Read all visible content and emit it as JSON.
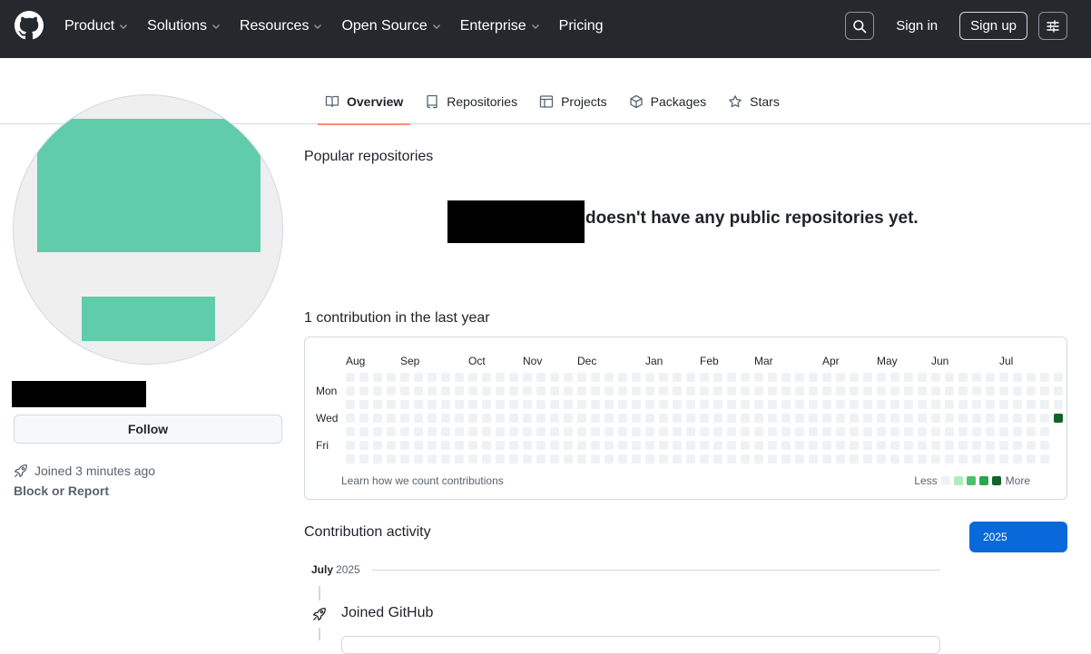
{
  "header": {
    "nav": [
      {
        "label": "Product",
        "dropdown": true
      },
      {
        "label": "Solutions",
        "dropdown": true
      },
      {
        "label": "Resources",
        "dropdown": true
      },
      {
        "label": "Open Source",
        "dropdown": true
      },
      {
        "label": "Enterprise",
        "dropdown": true
      },
      {
        "label": "Pricing",
        "dropdown": false
      }
    ],
    "sign_in": "Sign in",
    "sign_up": "Sign up"
  },
  "tabs": [
    {
      "label": "Overview",
      "icon": "book-icon",
      "active": true
    },
    {
      "label": "Repositories",
      "icon": "repo-icon",
      "active": false
    },
    {
      "label": "Projects",
      "icon": "table-icon",
      "active": false
    },
    {
      "label": "Packages",
      "icon": "package-icon",
      "active": false
    },
    {
      "label": "Stars",
      "icon": "star-icon",
      "active": false
    }
  ],
  "sidebar": {
    "follow_label": "Follow",
    "joined": "Joined 3 minutes ago",
    "block_report": "Block or Report"
  },
  "popular": {
    "title": "Popular repositories",
    "empty_message": "doesn't have any public repositories yet."
  },
  "contributions": {
    "title": "1 contribution in the last year",
    "months": [
      "Aug",
      "Sep",
      "Oct",
      "Nov",
      "Dec",
      "Jan",
      "Feb",
      "Mar",
      "Apr",
      "May",
      "Jun",
      "Jul"
    ],
    "days": [
      "Mon",
      "Wed",
      "Fri"
    ],
    "learn_link": "Learn how we count contributions",
    "legend_less": "Less",
    "legend_more": "More",
    "colors": [
      "#eff2f5",
      "#aceebb",
      "#4ac26b",
      "#2da44e",
      "#116329"
    ],
    "total": 1
  },
  "activity": {
    "title": "Contribution activity",
    "year": "2025",
    "month": "July",
    "month_year": "2025",
    "event": "Joined GitHub"
  }
}
